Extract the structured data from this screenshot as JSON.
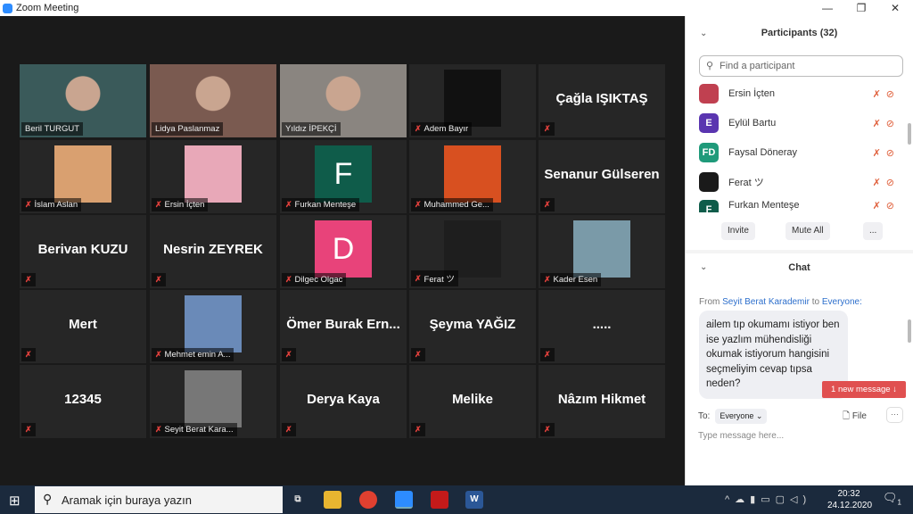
{
  "window": {
    "title": "Zoom Meeting",
    "controls": [
      "—",
      "❐",
      "✕"
    ]
  },
  "colors": {
    "active_speaker": "#c6e03a",
    "muted": "#e0403c",
    "accent": "#2d8cff",
    "new_message": "#e05050"
  },
  "gallery": {
    "tiles": [
      {
        "label": "Beril TURGUT",
        "kind": "video",
        "muted": false,
        "active": true,
        "bg": "#3a5a5a"
      },
      {
        "label": "Lidya Paslanmaz",
        "kind": "video",
        "muted": false,
        "bg": "#7a5a50"
      },
      {
        "label": "Yıldız İPEKÇİ",
        "kind": "video",
        "muted": false,
        "bg": "#8a8580"
      },
      {
        "label": "Adem Bayır",
        "kind": "avatar",
        "muted": true,
        "bg": "#111"
      },
      {
        "label": "Çağla IŞIKTAŞ",
        "kind": "text",
        "muted": true
      },
      {
        "label": "İslam Aslan",
        "kind": "avatar",
        "muted": true,
        "bg": "#d9a070"
      },
      {
        "label": "Ersin İçten",
        "kind": "avatar",
        "muted": true,
        "bg": "#e8a8b8"
      },
      {
        "label": "Furkan Menteşe",
        "kind": "letter",
        "letter": "F",
        "muted": true,
        "bg": "#0f5c4a"
      },
      {
        "label": "Muhammed Ge...",
        "kind": "avatar",
        "muted": true,
        "bg": "#d85020"
      },
      {
        "label": "Senanur Gülseren",
        "kind": "text",
        "muted": true
      },
      {
        "label": "Berivan KUZU",
        "kind": "text",
        "muted": true
      },
      {
        "label": "Nesrin ZEYREK",
        "kind": "text",
        "muted": true
      },
      {
        "label": "Dilgec Olgac",
        "kind": "letter",
        "letter": "D",
        "muted": true,
        "bg": "#e8437a"
      },
      {
        "label": "Ferat ツ",
        "kind": "avatar",
        "muted": true,
        "bg": "#1e1e1e"
      },
      {
        "label": "Kader Esen",
        "kind": "avatar",
        "muted": true,
        "bg": "#7a9aa8"
      },
      {
        "label": "Mert",
        "kind": "text",
        "muted": true
      },
      {
        "label": "Mehmet emin A...",
        "kind": "avatar",
        "muted": true,
        "bg": "#6a8ab8"
      },
      {
        "label": "Ömer  Burak  Ern...",
        "kind": "text",
        "muted": true
      },
      {
        "label": "Şeyma YAĞIZ",
        "kind": "text",
        "muted": true
      },
      {
        "label": ".....",
        "kind": "text",
        "muted": true
      },
      {
        "label": "12345",
        "kind": "text",
        "muted": true
      },
      {
        "label": "Seyit Berat Kara...",
        "kind": "avatar",
        "muted": true,
        "bg": "#777"
      },
      {
        "label": "Derya Kaya",
        "kind": "text",
        "muted": true
      },
      {
        "label": "Melike",
        "kind": "text",
        "muted": true
      },
      {
        "label": "Nâzım Hikmet",
        "kind": "text",
        "muted": true
      }
    ]
  },
  "participants": {
    "title": "Participants (32)",
    "search_placeholder": "Find a participant",
    "list": [
      {
        "name": "Ersin İçten",
        "initials": "",
        "color": "#c04050"
      },
      {
        "name": "Eylül Bartu",
        "initials": "E",
        "color": "#5a35b0"
      },
      {
        "name": "Faysal Döneray",
        "initials": "FD",
        "color": "#1f9a7a"
      },
      {
        "name": "Ferat ツ",
        "initials": "",
        "color": "#1a1a1a"
      },
      {
        "name": "Furkan Menteşe",
        "initials": "F",
        "color": "#0f5c4a"
      }
    ],
    "invite": "Invite",
    "mute_all": "Mute All",
    "more": "..."
  },
  "chat": {
    "title": "Chat",
    "from_prefix": "From",
    "sender": "Seyit Berat Karademir",
    "to_word": "to",
    "recipient": "Everyone:",
    "message": "ailem tıp okumamı istiyor ben ise yazlım mühendisliği okumak istiyorum hangisini seçmeliyim cevap tıpsa neden?",
    "new_message": "1 new message ↓",
    "to_label": "To:",
    "to_value": "Everyone ⌄",
    "file": "File",
    "more": "···",
    "placeholder": "Type message here..."
  },
  "taskbar": {
    "search_placeholder": "Aramak için buraya yazın",
    "time": "20:32",
    "date": "24.12.2020",
    "notifications": "1"
  }
}
